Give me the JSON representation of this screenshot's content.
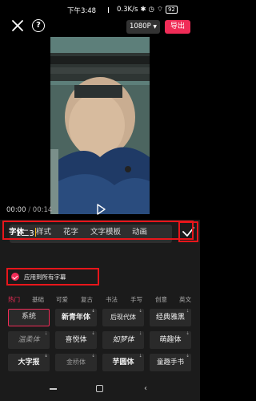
{
  "status": {
    "time": "下午3:48",
    "speed": "0.3K/s",
    "battery": "92"
  },
  "toolbar": {
    "resolution": "1080P",
    "export_label": "导出"
  },
  "player": {
    "current_time": "00:00",
    "separator": "/",
    "total_time": "00:14"
  },
  "text_input": {
    "value": "1二3"
  },
  "tabs": [
    {
      "label": "字体",
      "active": true
    },
    {
      "label": "样式",
      "active": false
    },
    {
      "label": "花字",
      "active": false
    },
    {
      "label": "文字模板",
      "active": false
    },
    {
      "label": "动画",
      "active": false
    }
  ],
  "apply_all": {
    "label": "应用到所有字幕",
    "checked": true
  },
  "categories": [
    {
      "label": "热门",
      "active": true
    },
    {
      "label": "基础",
      "active": false
    },
    {
      "label": "可爱",
      "active": false
    },
    {
      "label": "复古",
      "active": false
    },
    {
      "label": "书法",
      "active": false
    },
    {
      "label": "手写",
      "active": false
    },
    {
      "label": "创意",
      "active": false
    },
    {
      "label": "英文",
      "active": false
    }
  ],
  "fonts": [
    {
      "label": "系统",
      "selected": true
    },
    {
      "label": "新青年体",
      "selected": false
    },
    {
      "label": "后现代体",
      "selected": false
    },
    {
      "label": "经典雅黑",
      "selected": false
    },
    {
      "label": "温柔体",
      "selected": false
    },
    {
      "label": "喜悦体",
      "selected": false
    },
    {
      "label": "如梦体",
      "selected": false
    },
    {
      "label": "萌趣体",
      "selected": false
    },
    {
      "label": "大字报",
      "selected": false
    },
    {
      "label": "金桥体",
      "selected": false
    },
    {
      "label": "芋圆体",
      "selected": false
    },
    {
      "label": "童趣手书",
      "selected": false
    }
  ],
  "colors": {
    "accent": "#f02c57",
    "highlight_box": "#e8161b",
    "panel": "#1b1b1b"
  }
}
